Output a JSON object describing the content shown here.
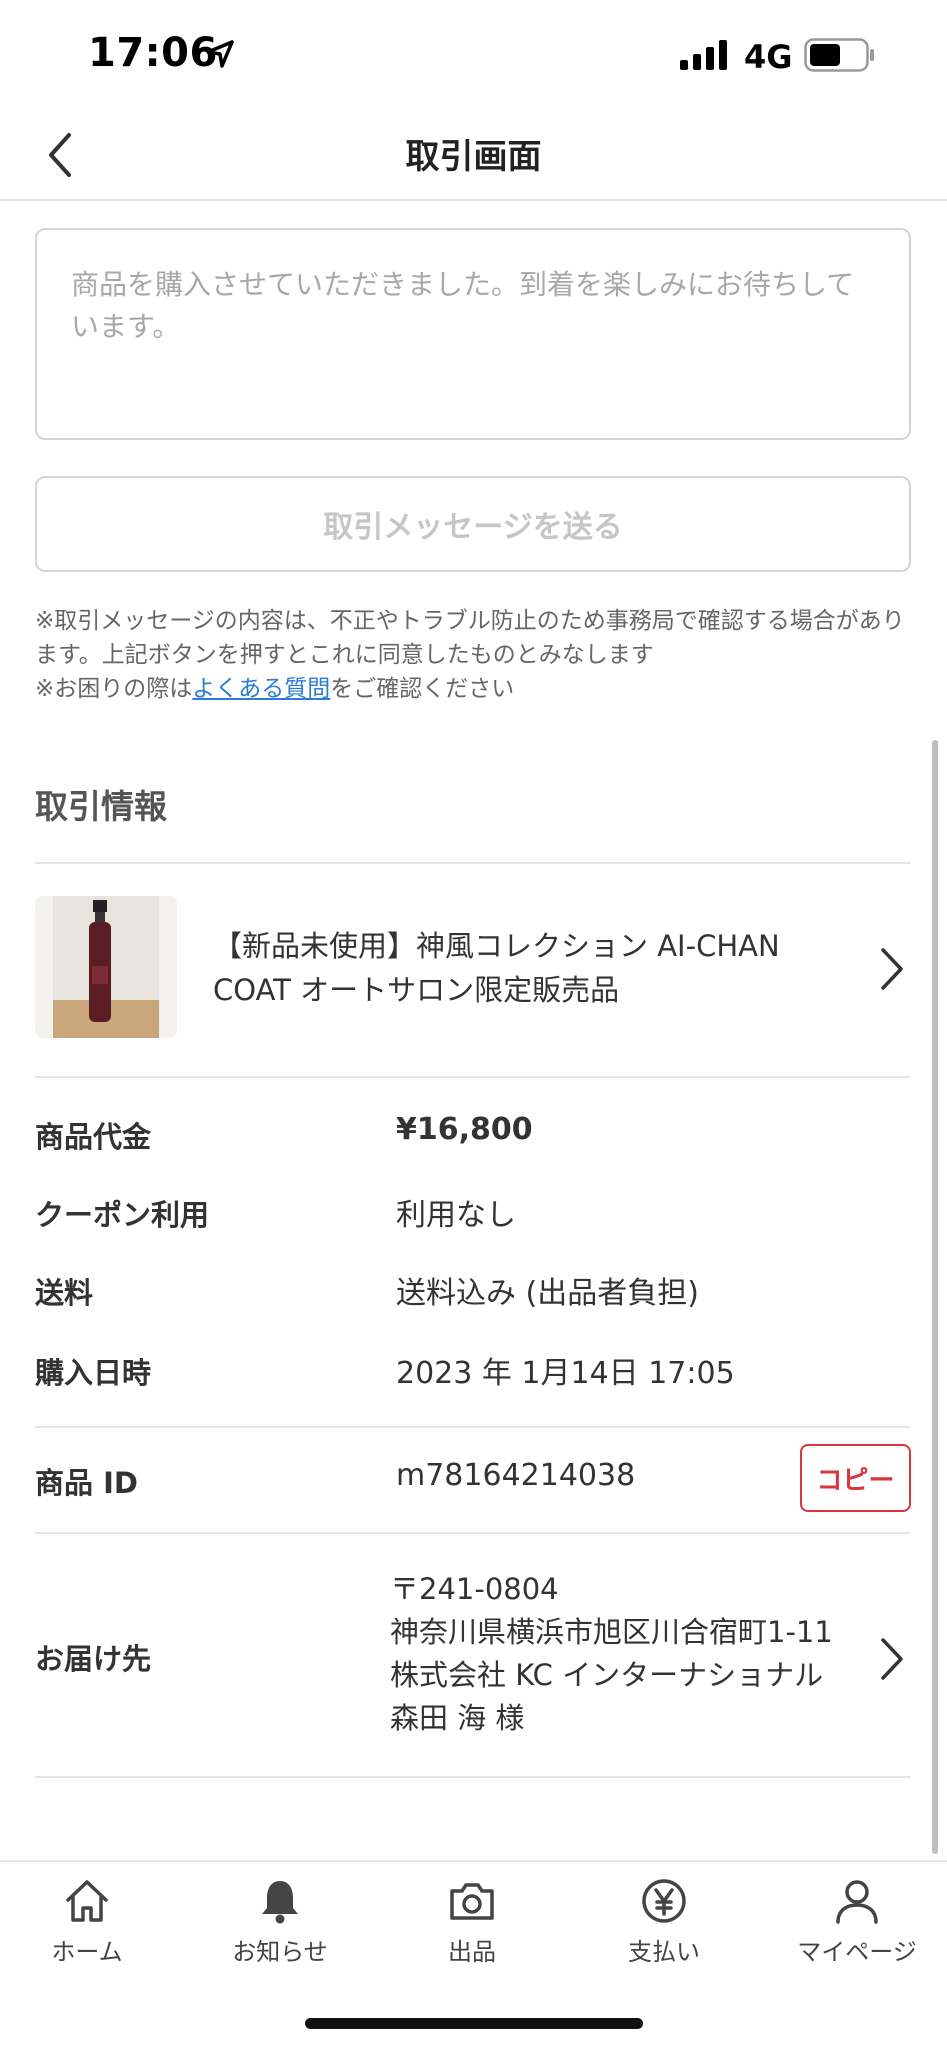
{
  "status_bar": {
    "time": "17:06",
    "network": "4G"
  },
  "header": {
    "title": "取引画面"
  },
  "message": {
    "placeholder": "商品を購入させていただきました。到着を楽しみにお待ちしています。",
    "send_label": "取引メッセージを送る"
  },
  "notes": {
    "line1": "※取引メッセージの内容は、不正やトラブル防止のため事務局で確認する場合があります。上記ボタンを押すとこれに同意したものとみなします",
    "line2_prefix": "※お困りの際は",
    "faq_link": "よくある質問",
    "line2_suffix": "をご確認ください"
  },
  "section": {
    "title": "取引情報"
  },
  "product": {
    "name": "【新品未使用】神風コレクション AI-CHAN COAT オートサロン限定販売品"
  },
  "details": {
    "price_label": "商品代金",
    "price_value": "¥16,800",
    "coupon_label": "クーポン利用",
    "coupon_value": "利用なし",
    "shipping_label": "送料",
    "shipping_value": "送料込み (出品者負担)",
    "date_label": "購入日時",
    "date_value": "2023 年 1月14日 17:05",
    "id_label": "商品 ID",
    "id_value": "m78164214038",
    "copy_label": "コピー"
  },
  "delivery": {
    "label": "お届け先",
    "postal": "〒241-0804",
    "address": "神奈川県横浜市旭区川合宿町1-11",
    "company": "株式会社 KC インターナショナル",
    "name": "森田 海 様"
  },
  "tabs": [
    {
      "label": "ホーム",
      "icon": "home-icon"
    },
    {
      "label": "お知らせ",
      "icon": "bell-icon"
    },
    {
      "label": "出品",
      "icon": "camera-icon"
    },
    {
      "label": "支払い",
      "icon": "yen-icon"
    },
    {
      "label": "マイページ",
      "icon": "person-icon"
    }
  ],
  "colors": {
    "accent_red": "#d9363e",
    "link_blue": "#2d7bd4"
  }
}
